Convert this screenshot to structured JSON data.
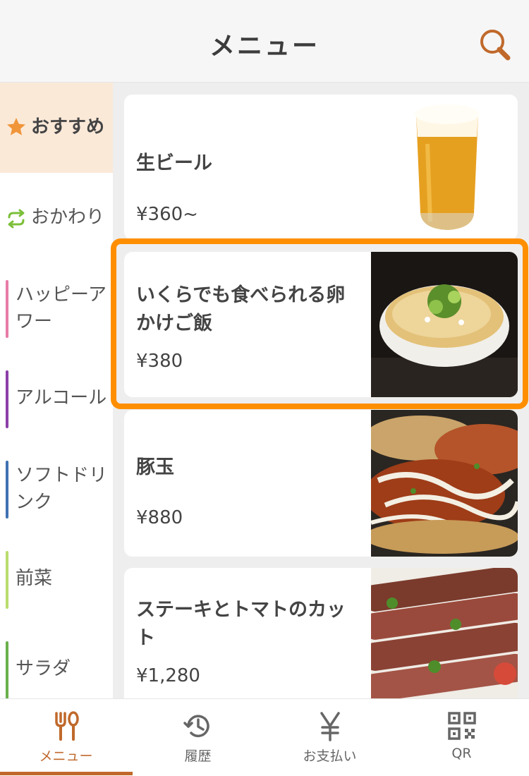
{
  "header": {
    "title": "メニュー",
    "search_icon": "search-icon"
  },
  "sidebar": {
    "items": [
      {
        "label": "おすすめ",
        "icon": "star-icon",
        "active": true
      },
      {
        "label": "おかわり",
        "icon": "refresh-icon",
        "active": false
      },
      {
        "label": "ハッピーアワー",
        "accent": "#e77ca7"
      },
      {
        "label": "アルコール",
        "accent": "#8d3fa8"
      },
      {
        "label": "ソフトドリンク",
        "accent": "#3f72b2"
      },
      {
        "label": "前菜",
        "accent": "#b9dd6e"
      },
      {
        "label": "サラダ",
        "accent": "#6ab04c"
      }
    ]
  },
  "menu": {
    "items": [
      {
        "name": "生ビール",
        "price": "¥360~",
        "image": "beer-glass"
      },
      {
        "name": "いくらでも食べられる卵かけご飯",
        "price": "¥380",
        "image": "egg-rice-bowl",
        "selected": true
      },
      {
        "name": "豚玉",
        "price": "¥880",
        "image": "okonomiyaki"
      },
      {
        "name": "ステーキとトマトのカット",
        "price": "¥1,280",
        "image": "sliced-steak-tomato"
      }
    ]
  },
  "bottom_nav": {
    "items": [
      {
        "label": "メニュー",
        "icon": "fork-spoon-icon",
        "active": true
      },
      {
        "label": "履歴",
        "icon": "history-icon"
      },
      {
        "label": "お支払い",
        "icon": "yen-icon"
      },
      {
        "label": "QR",
        "icon": "qr-code-icon"
      }
    ]
  },
  "colors": {
    "accent": "#c0692b",
    "highlight": "#ff8f00",
    "active_bg": "#fbe9d8",
    "star": "#f0953a",
    "refresh": "#7cbf3a"
  }
}
